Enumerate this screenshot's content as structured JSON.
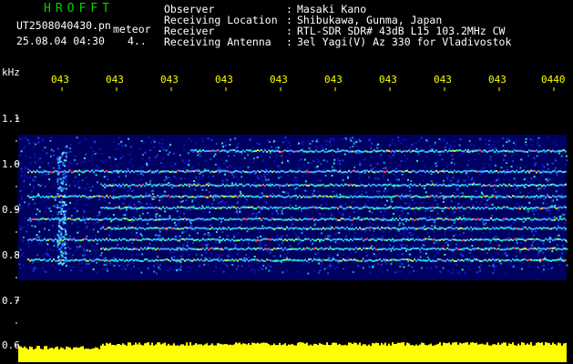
{
  "header": {
    "app_title": "HROFFT",
    "filename": "UT2508040430.pn",
    "meteor_label": "meteor",
    "datetime": "25.08.04 04:30",
    "count": "4..",
    "fields": [
      {
        "label": "Observer",
        "sep": ":",
        "value": "Masaki Kano"
      },
      {
        "label": "Receiving Location",
        "sep": ":",
        "value": "Shibukawa, Gunma, Japan"
      },
      {
        "label": "Receiver",
        "sep": ":",
        "value": "RTL-SDR SDR# 43dB L15 103.2MHz CW"
      },
      {
        "label": "Receiving Antenna",
        "sep": ":",
        "value": "3el Yagi(V) Az 330 for Vladivostok"
      }
    ]
  },
  "spectrogram": {
    "unit_label": "kHz",
    "time_ticks": [
      "043",
      "043",
      "043",
      "043",
      "043",
      "043",
      "043",
      "043",
      "043",
      "0440"
    ],
    "freq_ticks": [
      "1.1",
      "1.0",
      "0.9",
      "0.8",
      "0.7",
      "0.6"
    ],
    "freq_range": [
      0.6,
      1.15
    ],
    "background_color": "#000060",
    "bottom_bar_color": "#ffff00",
    "traces_khz": [
      1.03,
      0.985,
      0.955,
      0.93,
      0.905,
      0.88,
      0.86,
      0.835,
      0.815,
      0.79
    ]
  }
}
